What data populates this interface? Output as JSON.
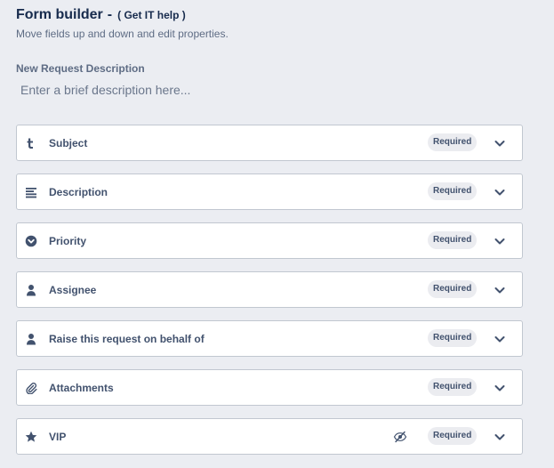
{
  "header": {
    "title": "Form builder",
    "separator": "-",
    "project": "( Get IT help )",
    "subtitle": "Move fields up and down and edit properties."
  },
  "description": {
    "label": "New Request Description",
    "placeholder": "Enter a brief description here...",
    "value": ""
  },
  "fields": [
    {
      "name": "Subject",
      "icon": "text-t-icon",
      "badge": "Required",
      "hidden": false
    },
    {
      "name": "Description",
      "icon": "paragraph-lines-icon",
      "badge": "Required",
      "hidden": false
    },
    {
      "name": "Priority",
      "icon": "priority-circle-chevron-icon",
      "badge": "Required",
      "hidden": false
    },
    {
      "name": "Assignee",
      "icon": "person-icon",
      "badge": "Required",
      "hidden": false
    },
    {
      "name": "Raise this request on behalf of",
      "icon": "person-icon",
      "badge": "Required",
      "hidden": false
    },
    {
      "name": "Attachments",
      "icon": "paperclip-icon",
      "badge": "Required",
      "hidden": false
    },
    {
      "name": "VIP",
      "icon": "star-icon",
      "badge": "Required",
      "hidden": true
    }
  ],
  "colors": {
    "background": "#ebedf2",
    "card": "#ffffff",
    "border": "#c1c7d0",
    "text": "#172b4d",
    "muted": "#5e6c84",
    "badge_bg": "#ebecf0"
  }
}
